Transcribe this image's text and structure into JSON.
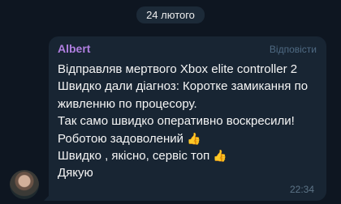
{
  "chat": {
    "date_label": "24 лютого",
    "message": {
      "sender": "Albert",
      "reply_label": "Відповісти",
      "lines": [
        "Відправляв мертвого Xbox elite controller 2",
        "Швидко дали діагноз: Коротке замикання по",
        "живленню по процесору.",
        "Так само швидко оперативно воскресили!",
        "Роботою задоволений",
        "Швидко , якісно, сервіс топ",
        "Дякую"
      ],
      "time": "22:34"
    },
    "icons": {
      "thumbs_up": "thumbs-up-emoji",
      "avatar": "user-avatar"
    },
    "colors": {
      "background": "#0e1621",
      "bubble": "#182533",
      "sender": "#b07fe0",
      "reply": "#4f6a83"
    }
  }
}
